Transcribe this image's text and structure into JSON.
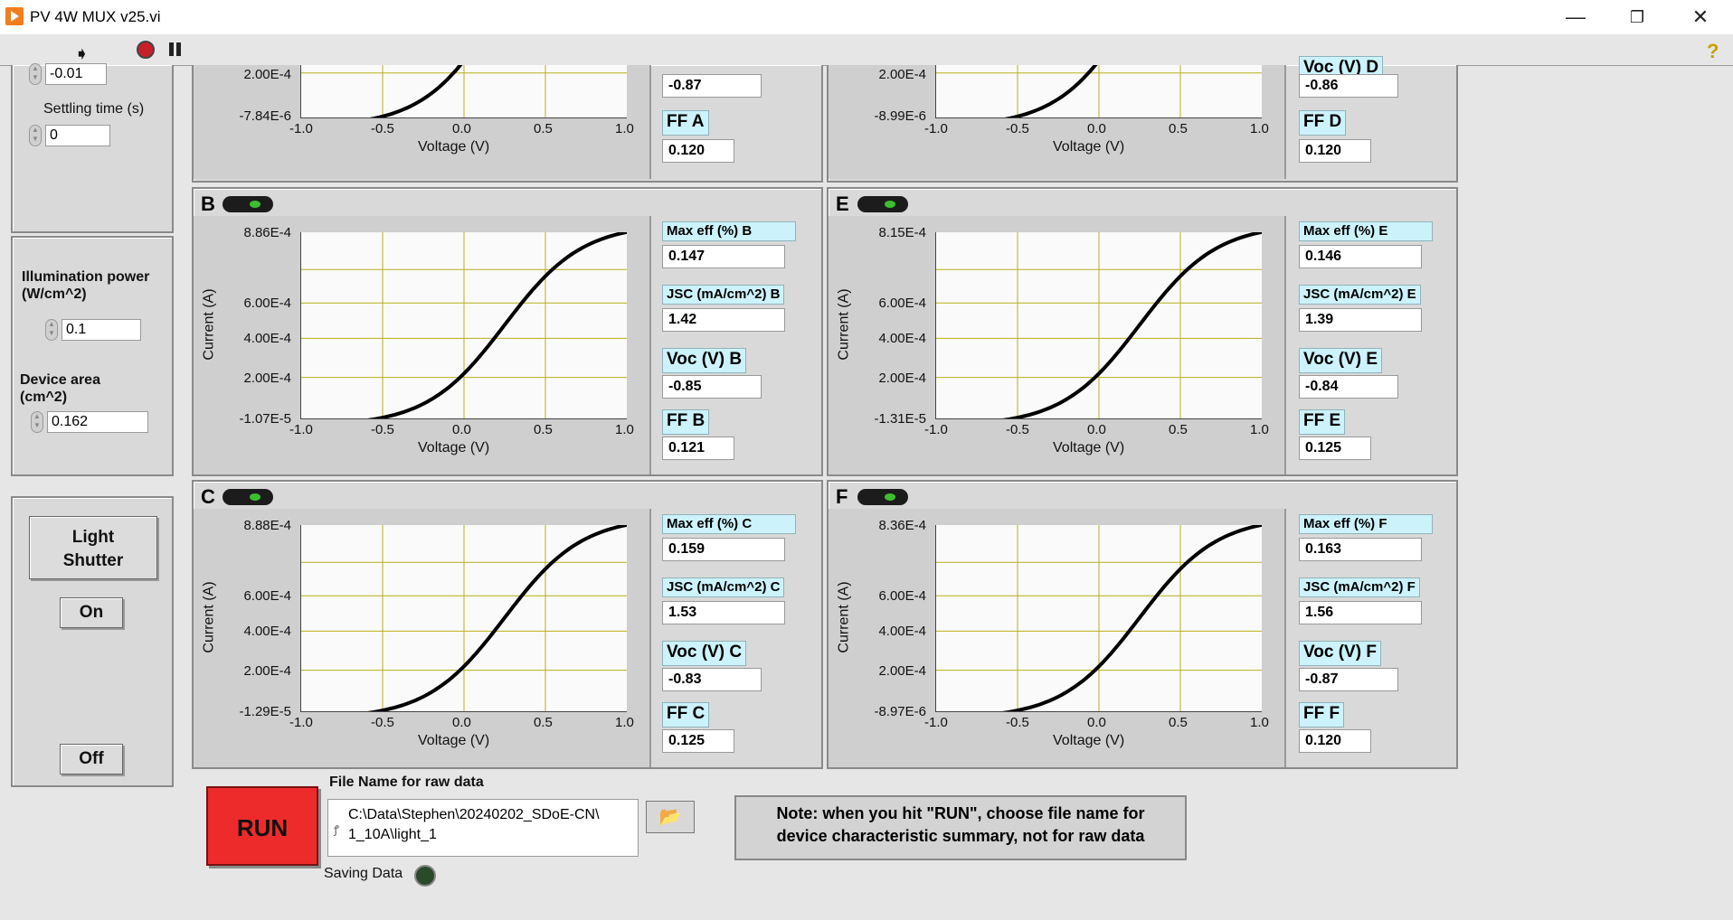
{
  "window": {
    "title": "PV 4W MUX v25.vi",
    "min": "—",
    "restore": "❐",
    "close": "✕"
  },
  "toolbar": {
    "run_icon": "run-arrow-icon",
    "stop_icon": "abort-icon",
    "pause_icon": "pause-icon",
    "help": "?"
  },
  "settings": {
    "step_value": "-0.01",
    "settling_label": "Settling time (s)",
    "settling_value": "0",
    "illum_label_1": "Illumination power",
    "illum_label_2": "(W/cm^2)",
    "illum_value": "0.1",
    "area_label_1": "Device area",
    "area_label_2": "(cm^2)",
    "area_value": "0.162"
  },
  "shutter": {
    "label_1": "Light",
    "label_2": "Shutter",
    "on": "On",
    "off": "Off"
  },
  "devices": [
    {
      "id": "A",
      "ymax": "",
      "ymin": "-7.84E-6",
      "y2": "2.00E-4",
      "eff_label": "",
      "eff": "",
      "jsc_label": "",
      "jsc": "",
      "voc_label": "",
      "voc": "-0.87",
      "ff_label": "FF A",
      "ff": "0.120"
    },
    {
      "id": "D",
      "ymax": "",
      "ymin": "-8.99E-6",
      "y2": "2.00E-4",
      "eff_label": "",
      "eff": "",
      "jsc_label": "",
      "jsc": "",
      "voc_label": "Voc (V) D",
      "voc": "-0.86",
      "ff_label": "FF D",
      "ff": "0.120"
    },
    {
      "id": "B",
      "ymax": "8.86E-4",
      "ymin": "-1.07E-5",
      "y2": "2.00E-4",
      "y4": "4.00E-4",
      "y6": "6.00E-4",
      "eff_label": "Max eff (%) B",
      "eff": "0.147",
      "jsc_label": "JSC (mA/cm^2) B",
      "jsc": "1.42",
      "voc_label": "Voc (V) B",
      "voc": "-0.85",
      "ff_label": "FF B",
      "ff": "0.121"
    },
    {
      "id": "E",
      "ymax": "8.15E-4",
      "ymin": "-1.31E-5",
      "y2": "2.00E-4",
      "y4": "4.00E-4",
      "y6": "6.00E-4",
      "eff_label": "Max eff (%) E",
      "eff": "0.146",
      "jsc_label": "JSC (mA/cm^2) E",
      "jsc": "1.39",
      "voc_label": "Voc (V) E",
      "voc": "-0.84",
      "ff_label": "FF E",
      "ff": "0.125"
    },
    {
      "id": "C",
      "ymax": "8.88E-4",
      "ymin": "-1.29E-5",
      "y2": "2.00E-4",
      "y4": "4.00E-4",
      "y6": "6.00E-4",
      "eff_label": "Max eff (%) C",
      "eff": "0.159",
      "jsc_label": "JSC (mA/cm^2) C",
      "jsc": "1.53",
      "voc_label": "Voc (V) C",
      "voc": "-0.83",
      "ff_label": "FF C",
      "ff": "0.125"
    },
    {
      "id": "F",
      "ymax": "8.36E-4",
      "ymin": "-8.97E-6",
      "y2": "2.00E-4",
      "y4": "4.00E-4",
      "y6": "6.00E-4",
      "eff_label": "Max eff (%) F",
      "eff": "0.163",
      "jsc_label": "JSC (mA/cm^2) F",
      "jsc": "1.56",
      "voc_label": "Voc (V) F",
      "voc": "-0.87",
      "ff_label": "FF F",
      "ff": "0.120"
    }
  ],
  "axes": {
    "xlabel": "Voltage (V)",
    "ylabel": "Current (A)",
    "xticks": [
      "-1.0",
      "-0.5",
      "0.0",
      "0.5",
      "1.0"
    ]
  },
  "bottom": {
    "run": "RUN",
    "file_label": "File Name for raw data",
    "path_line1": "C:\\Data\\Stephen\\20240202_SDoE-CN\\",
    "path_line2": "1_10A\\light_1",
    "saving_label": "Saving Data",
    "note_line1": "Note: when you hit \"RUN\", choose file name for",
    "note_line2": "device characteristic summary, not for raw data"
  }
}
